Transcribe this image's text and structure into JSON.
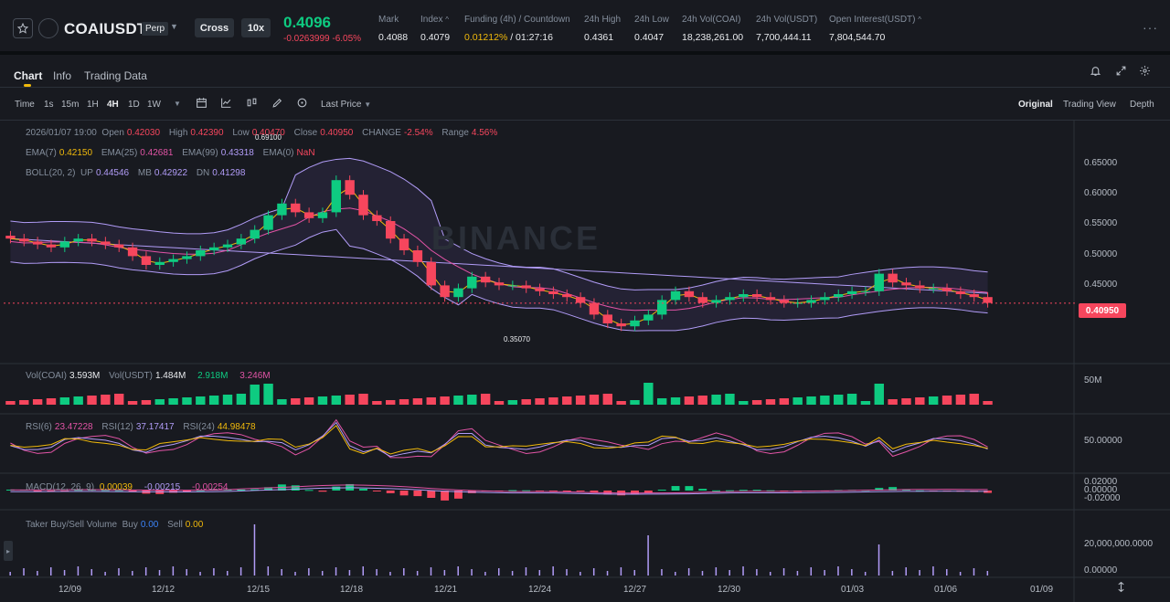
{
  "ticker": {
    "symbol": "COAIUSDT",
    "contract_type": "Perp",
    "margin_mode": "Cross",
    "leverage": "10x",
    "last_price": "0.4096",
    "change": "-0.0263999 -6.05%",
    "stats": [
      {
        "label": "Mark",
        "value": "0.4088"
      },
      {
        "label": "Index",
        "value": "0.4079"
      },
      {
        "label": "Funding (4h) / Countdown",
        "value_rate": "0.01212%",
        "value_countdown": " / 01:27:16"
      },
      {
        "label": "24h High",
        "value": "0.4361"
      },
      {
        "label": "24h Low",
        "value": "0.4047"
      },
      {
        "label": "24h Vol(COAI)",
        "value": "18,238,261.00"
      },
      {
        "label": "24h Vol(USDT)",
        "value": "7,700,444.11"
      },
      {
        "label": "Open Interest(USDT)",
        "value": "7,804,544.70"
      }
    ],
    "icons": [
      "star-icon",
      "more-icon"
    ]
  },
  "tabs": {
    "items": [
      "Chart",
      "Info",
      "Trading Data"
    ],
    "active": "Chart",
    "right_icons": [
      "bell-icon",
      "expand-icon",
      "settings-icon"
    ]
  },
  "toolbar": {
    "time_label": "Time",
    "intervals": [
      "1s",
      "15m",
      "1H",
      "4H",
      "1D",
      "1W"
    ],
    "active_interval": "4H",
    "price_type": "Last Price",
    "views": [
      "Original",
      "Trading View",
      "Depth"
    ],
    "active_view": "Original"
  },
  "legend": {
    "ohlc": {
      "date": "2026/01/07 19:00",
      "open_label": "Open",
      "open": "0.42030",
      "high_label": "High",
      "high": "0.42390",
      "low_label": "Low",
      "low": "0.40470",
      "close_label": "Close",
      "close": "0.40950",
      "change_label": "CHANGE",
      "change": "-2.54%",
      "range_label": "Range",
      "range": "4.56%"
    },
    "ema": {
      "ema7_label": "EMA(7)",
      "ema7": "0.42150",
      "ema25_label": "EMA(25)",
      "ema25": "0.42681",
      "ema99_label": "EMA(99)",
      "ema99": "0.43318",
      "ema0_label": "EMA(0)",
      "ema0": "NaN"
    },
    "boll": {
      "label": "BOLL(20, 2)",
      "up_label": "UP",
      "up": "0.44546",
      "mb_label": "MB",
      "mb": "0.42922",
      "dn_label": "DN",
      "dn": "0.41298"
    },
    "vol": {
      "coai_label": "Vol(COAI)",
      "coai": "3.593M",
      "usdt_label": "Vol(USDT)",
      "usdt": "1.484M",
      "usdt_ma1": "2.918M",
      "usdt_ma2": "3.246M"
    },
    "rsi": {
      "rsi6_label": "RSI(6)",
      "rsi6": "23.47228",
      "rsi12_label": "RSI(12)",
      "rsi12": "37.17417",
      "rsi24_label": "RSI(24)",
      "rsi24": "44.98478"
    },
    "macd": {
      "label": "MACD(12, 26, 9)",
      "v1": "0.00039",
      "v2": "-0.00215",
      "v3": "-0.00254"
    },
    "taker": {
      "label": "Taker Buy/Sell Volume",
      "buy_label": "Buy",
      "buy": "0.00",
      "sell_label": "Sell",
      "sell": "0.00"
    }
  },
  "price_axis": [
    "0.65000",
    "0.60000",
    "0.55000",
    "0.50000",
    "0.45000"
  ],
  "current_price_tag": "0.40950",
  "high_annotation": "0.69100",
  "low_annotation": "0.35070",
  "vol_axis": [
    "50M"
  ],
  "rsi_axis": [
    "50.00000"
  ],
  "macd_axis": [
    "0.02000",
    "0.00000",
    "-0.02000"
  ],
  "taker_axis": [
    "20,000,000.0000",
    "0.00000"
  ],
  "date_axis": [
    "12/09",
    "12/12",
    "12/15",
    "12/18",
    "12/21",
    "12/24",
    "12/27",
    "12/30",
    "01/03",
    "01/06",
    "01/09"
  ],
  "watermark": "BINANCE",
  "colors": {
    "up": "#0ecb81",
    "down": "#f6465d",
    "accent": "#f0b90b",
    "ema7": "#f0b90b",
    "ema25": "#e254a6",
    "ema99": "#b19cf7",
    "boll": "#b19cf7"
  },
  "chart_data": {
    "type": "candlestick",
    "interval": "4H",
    "candle_closes_approx": [
      0.52,
      0.515,
      0.51,
      0.505,
      0.515,
      0.52,
      0.515,
      0.51,
      0.505,
      0.49,
      0.475,
      0.48,
      0.485,
      0.49,
      0.5,
      0.505,
      0.51,
      0.52,
      0.535,
      0.56,
      0.58,
      0.565,
      0.555,
      0.565,
      0.62,
      0.595,
      0.56,
      0.55,
      0.52,
      0.5,
      0.48,
      0.44,
      0.42,
      0.435,
      0.455,
      0.445,
      0.44,
      0.44,
      0.435,
      0.43,
      0.425,
      0.42,
      0.41,
      0.39,
      0.375,
      0.37,
      0.38,
      0.39,
      0.415,
      0.43,
      0.42,
      0.41,
      0.415,
      0.42,
      0.425,
      0.42,
      0.415,
      0.41,
      0.41,
      0.415,
      0.42,
      0.425,
      0.43,
      0.43,
      0.46,
      0.445,
      0.44,
      0.435,
      0.435,
      0.43,
      0.425,
      0.42,
      0.41
    ]
  }
}
